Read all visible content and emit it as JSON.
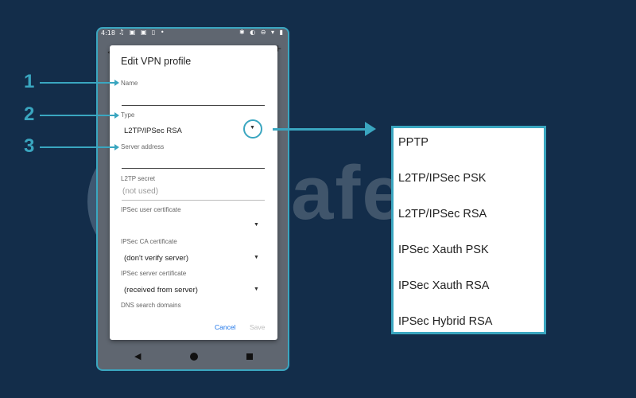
{
  "status_bar": {
    "time": "4:18",
    "left_icons": "♫ ▣ ▣ ▯ •",
    "right_icons": "✱ ◐ ⊖ ▾ ▮"
  },
  "dialog": {
    "title": "Edit VPN profile",
    "name_label": "Name",
    "name_value": "",
    "type_label": "Type",
    "type_value": "L2TP/IPSec RSA",
    "server_label": "Server address",
    "server_value": "",
    "l2tp_label": "L2TP secret",
    "l2tp_hint": "(not used)",
    "user_cert_label": "IPSec user certificate",
    "ca_cert_label": "IPSec CA certificate",
    "ca_cert_value": "(don't verify server)",
    "server_cert_label": "IPSec server certificate",
    "server_cert_value": "(received from server)",
    "dns_label": "DNS search domains",
    "cancel_label": "Cancel",
    "save_label": "Save"
  },
  "annotations": {
    "n1": "1",
    "n2": "2",
    "n3": "3"
  },
  "type_options": [
    "PPTP",
    "L2TP/IPSec PSK",
    "L2TP/IPSec RSA",
    "IPSec Xauth PSK",
    "IPSec Xauth RSA",
    "IPSec Hybrid RSA"
  ],
  "watermark": "Safelyo",
  "colors": {
    "background": "#132d4a",
    "accent": "#3aa6c0",
    "button_blue": "#1a73e8"
  }
}
